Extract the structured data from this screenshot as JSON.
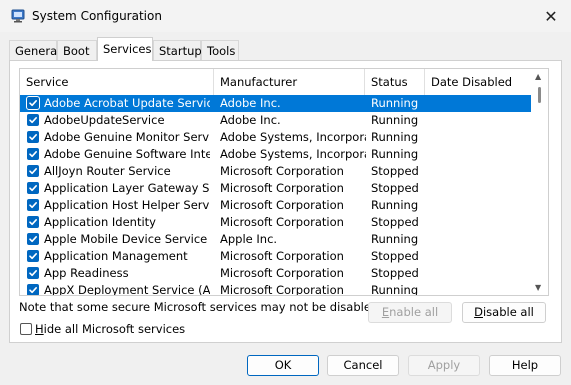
{
  "window": {
    "title": "System Configuration",
    "close_glyph": "✕"
  },
  "tabs": [
    {
      "label": "General"
    },
    {
      "label": "Boot"
    },
    {
      "label": "Services",
      "active": true
    },
    {
      "label": "Startup"
    },
    {
      "label": "Tools"
    }
  ],
  "table": {
    "headers": {
      "service": "Service",
      "manufacturer": "Manufacturer",
      "status": "Status",
      "date_disabled": "Date Disabled"
    },
    "rows": [
      {
        "checked": true,
        "service": "Adobe Acrobat Update Service",
        "manufacturer": "Adobe Inc.",
        "status": "Running",
        "date_disabled": "",
        "selected": true
      },
      {
        "checked": true,
        "service": "AdobeUpdateService",
        "manufacturer": "Adobe Inc.",
        "status": "Running",
        "date_disabled": ""
      },
      {
        "checked": true,
        "service": "Adobe Genuine Monitor Service",
        "manufacturer": "Adobe Systems, Incorpora...",
        "status": "Running",
        "date_disabled": ""
      },
      {
        "checked": true,
        "service": "Adobe Genuine Software Integri...",
        "manufacturer": "Adobe Systems, Incorpora...",
        "status": "Running",
        "date_disabled": ""
      },
      {
        "checked": true,
        "service": "AllJoyn Router Service",
        "manufacturer": "Microsoft Corporation",
        "status": "Stopped",
        "date_disabled": ""
      },
      {
        "checked": true,
        "service": "Application Layer Gateway Service",
        "manufacturer": "Microsoft Corporation",
        "status": "Stopped",
        "date_disabled": ""
      },
      {
        "checked": true,
        "service": "Application Host Helper Service",
        "manufacturer": "Microsoft Corporation",
        "status": "Running",
        "date_disabled": ""
      },
      {
        "checked": true,
        "service": "Application Identity",
        "manufacturer": "Microsoft Corporation",
        "status": "Stopped",
        "date_disabled": ""
      },
      {
        "checked": true,
        "service": "Apple Mobile Device Service",
        "manufacturer": "Apple Inc.",
        "status": "Running",
        "date_disabled": ""
      },
      {
        "checked": true,
        "service": "Application Management",
        "manufacturer": "Microsoft Corporation",
        "status": "Stopped",
        "date_disabled": ""
      },
      {
        "checked": true,
        "service": "App Readiness",
        "manufacturer": "Microsoft Corporation",
        "status": "Stopped",
        "date_disabled": ""
      },
      {
        "checked": true,
        "service": "AppX Deployment Service (AppX...",
        "manufacturer": "Microsoft Corporation",
        "status": "Running",
        "date_disabled": ""
      }
    ]
  },
  "note": "Note that some secure Microsoft services may not be disabled.",
  "buttons": {
    "enable_all": {
      "label": "Enable all",
      "mnemonic": "E",
      "rest": "nable all",
      "enabled": false
    },
    "disable_all": {
      "label": "Disable all",
      "mnemonic": "D",
      "rest": "isable all",
      "enabled": true
    },
    "ok": "OK",
    "cancel": "Cancel",
    "apply": "Apply",
    "help": "Help"
  },
  "hide_ms": {
    "label": "Hide all Microsoft services",
    "mnemonic": "H",
    "rest": "ide all Microsoft services",
    "checked": false
  },
  "colors": {
    "selection": "#0078d7",
    "checkbox": "#0067c0",
    "accent_border": "#0067c0"
  },
  "icons": {
    "app": "system-config-icon",
    "close": "close-icon",
    "check": "checkmark-icon"
  }
}
